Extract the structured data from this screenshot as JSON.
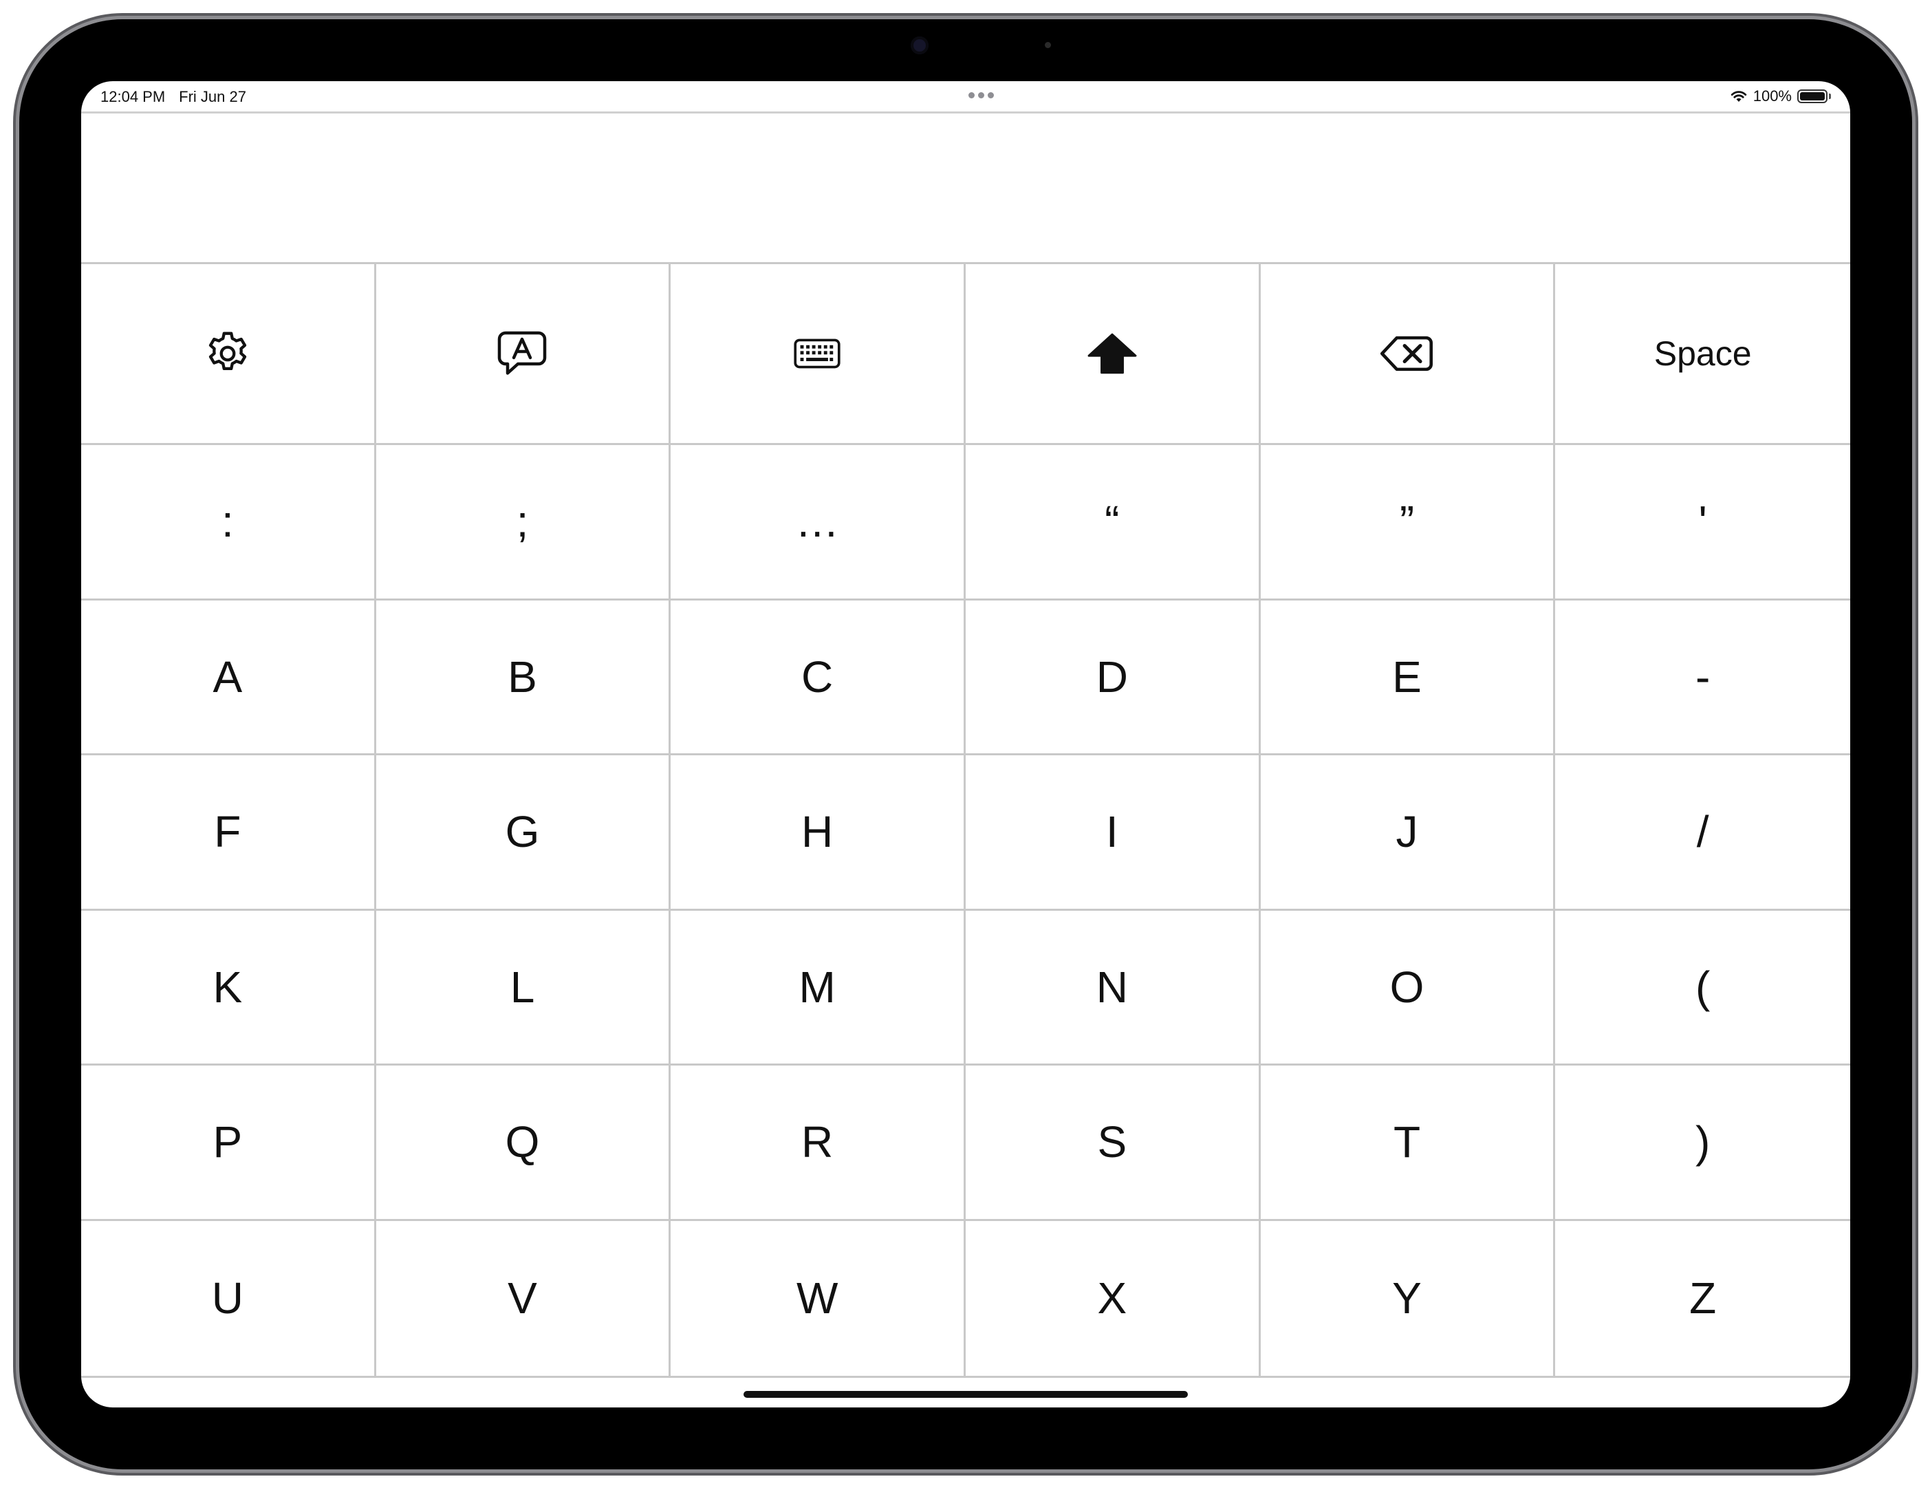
{
  "status_bar": {
    "time": "12:04 PM",
    "date": "Fri Jun 27",
    "battery_percent": "100%",
    "battery_level": 1.0,
    "icons": [
      "wifi-icon",
      "battery-icon"
    ]
  },
  "text_area": {
    "value": ""
  },
  "toolbar": [
    {
      "name": "settings-button",
      "icon": "gear-icon"
    },
    {
      "name": "speak-button",
      "icon": "speech-bubble-a-icon"
    },
    {
      "name": "keyboard-button",
      "icon": "keyboard-icon"
    },
    {
      "name": "shift-button",
      "icon": "shift-arrow-icon"
    },
    {
      "name": "delete-button",
      "icon": "delete-backward-icon"
    },
    {
      "name": "space-button",
      "label": "Space"
    }
  ],
  "punctuation_row": [
    ":",
    ";",
    "…",
    "“",
    "”",
    "'"
  ],
  "letter_rows": [
    [
      "A",
      "B",
      "C",
      "D",
      "E",
      "-"
    ],
    [
      "F",
      "G",
      "H",
      "I",
      "J",
      "/"
    ],
    [
      "K",
      "L",
      "M",
      "N",
      "O",
      "("
    ],
    [
      "P",
      "Q",
      "R",
      "S",
      "T",
      ")"
    ],
    [
      "U",
      "V",
      "W",
      "X",
      "Y",
      "Z"
    ]
  ],
  "colors": {
    "grid_line": "#c9c9c9",
    "key_background": "#ffffff",
    "text": "#111111",
    "bezel": "#000000"
  }
}
